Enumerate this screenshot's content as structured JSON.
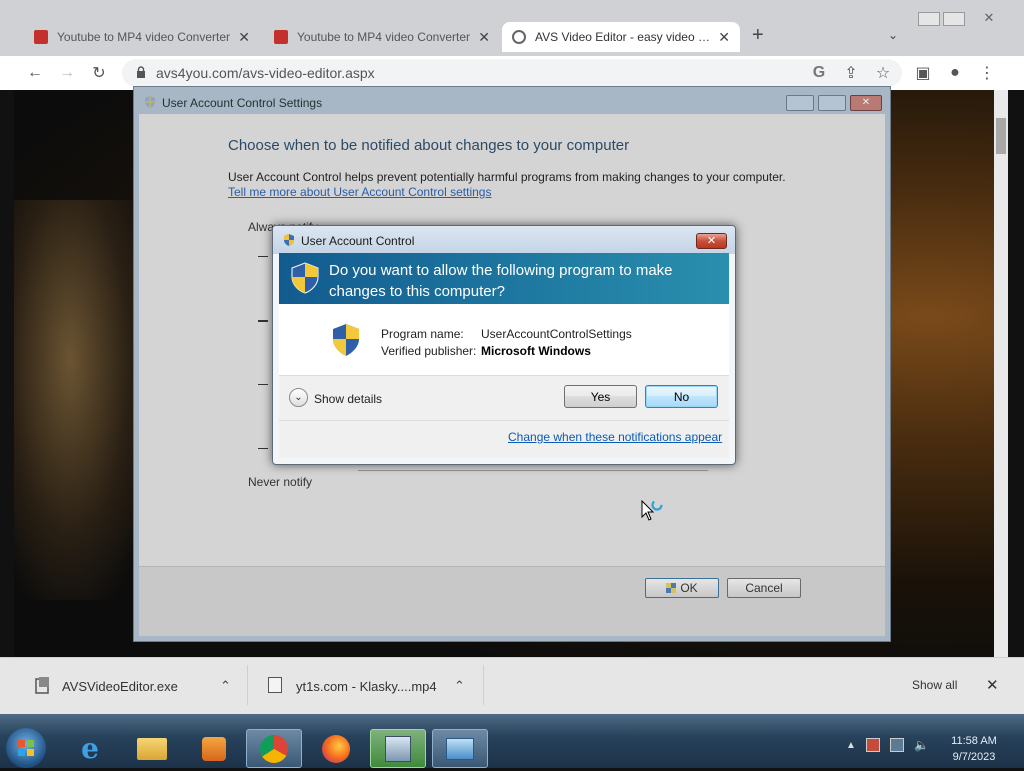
{
  "browser": {
    "tabs": [
      {
        "title": "Youtube to MP4 video Converter",
        "icon": "youtube-red-icon"
      },
      {
        "title": "Youtube to MP4 video Converter",
        "icon": "youtube-red-icon"
      },
      {
        "title": "AVS Video Editor - easy video ed",
        "icon": "globe-icon"
      }
    ],
    "url": "avs4you.com/avs-video-editor.aspx"
  },
  "uac_settings": {
    "title": "User Account Control Settings",
    "heading": "Choose when to be notified about changes to your computer",
    "description": "User Account Control helps prevent potentially harmful programs from making changes to your computer.",
    "link": "Tell me more about User Account Control settings",
    "always_label": "Always notify",
    "never_label": "Never notify",
    "ok": "OK",
    "cancel": "Cancel"
  },
  "uac_dialog": {
    "title": "User Account Control",
    "question": "Do you want to allow the following program to make changes to this computer?",
    "program_label": "Program name:",
    "program_value": "UserAccountControlSettings",
    "publisher_label": "Verified publisher:",
    "publisher_value": "Microsoft Windows",
    "show_details": "Show details",
    "yes": "Yes",
    "no": "No",
    "change_link": "Change when these notifications appear"
  },
  "downloads": {
    "items": [
      {
        "name": "AVSVideoEditor.exe"
      },
      {
        "name": "yt1s.com - Klasky....mp4"
      }
    ],
    "show_all": "Show all"
  },
  "taskbar": {
    "time": "11:58 AM",
    "date": "9/7/2023"
  },
  "colors": {
    "banner": "#1a6f9c",
    "link": "#0b5bb7",
    "taskbar": "#28435c"
  }
}
